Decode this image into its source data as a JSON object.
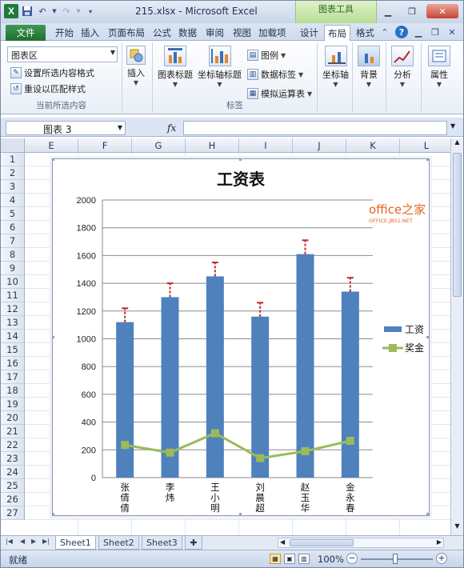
{
  "title_bar": {
    "filename": "215.xlsx",
    "separator": " - ",
    "app": "Microsoft Excel",
    "context_tools": "图表工具",
    "icons": [
      "excel-logo-icon",
      "save-icon",
      "undo-icon",
      "redo-icon",
      "customize-qat-icon"
    ],
    "window_buttons": [
      "minimize-icon",
      "restore-icon",
      "close-icon"
    ]
  },
  "tabs": {
    "file": "文件",
    "items": [
      "开始",
      "插入",
      "页面布局",
      "公式",
      "数据",
      "审阅",
      "视图",
      "加载项",
      "设计",
      "布局",
      "格式"
    ],
    "active": "布局"
  },
  "ribbon": {
    "current_selection": {
      "dropdown_value": "图表区",
      "format_selection": "设置所选内容格式",
      "reset_style": "重设以匹配样式",
      "group_label": "当前所选内容"
    },
    "insert": {
      "label": "插入"
    },
    "labels_group": {
      "chart_title": "图表标题",
      "axis_titles": "坐标轴标题",
      "legend": "图例",
      "data_labels": "数据标签",
      "data_table": "模拟运算表",
      "group_label": "标签"
    },
    "axes": {
      "label": "坐标轴"
    },
    "background": {
      "label": "背景"
    },
    "analysis": {
      "label": "分析"
    },
    "properties": {
      "label": "属性"
    }
  },
  "formula_bar": {
    "name_box": "图表 3",
    "fx_label": "fx",
    "formula": ""
  },
  "grid": {
    "columns": [
      "E",
      "F",
      "G",
      "H",
      "I",
      "J",
      "K",
      "L"
    ],
    "rows": [
      "1",
      "2",
      "3",
      "4",
      "5",
      "6",
      "7",
      "8",
      "9",
      "10",
      "11",
      "12",
      "13",
      "14",
      "15",
      "16",
      "17",
      "18",
      "19",
      "20",
      "21",
      "22",
      "23",
      "24",
      "25",
      "26",
      "27"
    ]
  },
  "chart_data": {
    "type": "bar",
    "title": "工资表",
    "watermark_main": "office之家",
    "watermark_sub": "OFFICE.JB51.NET",
    "categories": [
      "张倩倩",
      "李炜",
      "王小明",
      "刘晨超",
      "赵玉华",
      "金永春"
    ],
    "category_label_chars": [
      [
        "张",
        "倩",
        "倩"
      ],
      [
        "李",
        "炜"
      ],
      [
        "王",
        "小",
        "明"
      ],
      [
        "刘",
        "晨",
        "超"
      ],
      [
        "赵",
        "玉",
        "华"
      ],
      [
        "金",
        "永",
        "春"
      ]
    ],
    "series": [
      {
        "name": "工资",
        "kind": "bar",
        "color": "#4f81bd",
        "values": [
          1120,
          1300,
          1450,
          1160,
          1610,
          1340
        ],
        "error_bar": 100
      },
      {
        "name": "奖金",
        "kind": "line",
        "color": "#9bbb59",
        "values": [
          235,
          180,
          320,
          140,
          190,
          265
        ]
      }
    ],
    "error_bar_color": "#c0282d",
    "ylim": [
      0,
      2000
    ],
    "yticks": [
      "0",
      "200",
      "400",
      "600",
      "800",
      "1000",
      "1200",
      "1400",
      "1600",
      "1800",
      "2000"
    ],
    "grid": true,
    "legend_position": "right"
  },
  "sheets": {
    "tabs": [
      "Sheet1",
      "Sheet2",
      "Sheet3"
    ],
    "active": "Sheet1"
  },
  "status_bar": {
    "ready": "就绪",
    "zoom": "100%",
    "zoom_minus": "−",
    "zoom_plus": "+"
  }
}
